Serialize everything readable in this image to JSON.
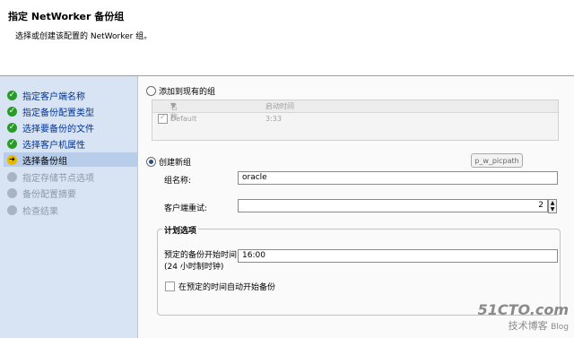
{
  "header": {
    "title": "指定 NetWorker 备份组",
    "subtitle": "选择或创建该配置的 NetWorker 组。"
  },
  "sidebar": {
    "steps": [
      {
        "label": "指定客户端名称",
        "state": "done",
        "icon": "check-icon"
      },
      {
        "label": "指定备份配置类型",
        "state": "done",
        "icon": "check-icon"
      },
      {
        "label": "选择要备份的文件",
        "state": "done",
        "icon": "check-icon"
      },
      {
        "label": "选择客户机属性",
        "state": "done",
        "icon": "check-icon"
      },
      {
        "label": "选择备份组",
        "state": "current",
        "icon": "arrow-right-icon"
      },
      {
        "label": "指定存储节点选项",
        "state": "pending",
        "icon": "pending-icon"
      },
      {
        "label": "备份配置摘要",
        "state": "pending",
        "icon": "pending-icon"
      },
      {
        "label": "检查结果",
        "state": "pending",
        "icon": "pending-icon"
      }
    ]
  },
  "main": {
    "existing_group_radio": "添加到现有的组",
    "group_table": {
      "columns": [
        "名称",
        "启动时间"
      ],
      "rows": [
        {
          "name": "Default",
          "start_time": "3:33",
          "checked": true
        }
      ]
    },
    "tooltip": "p_w_picpath",
    "new_group_radio": "创建新组",
    "group_name_label": "组名称:",
    "group_name_value": "oracle",
    "client_retries_label": "客户端重试:",
    "client_retries_value": "2",
    "schedule_title": "计划选项",
    "start_time_label_1": "预定的备份开始时间",
    "start_time_label_2": "(24 小时制时钟)",
    "start_time_value": "16:00",
    "auto_start_label": "在预定的时间自动开始备份"
  },
  "watermark": {
    "site": "51CTO.com",
    "tagline": "技术博客",
    "blog": "Blog"
  }
}
